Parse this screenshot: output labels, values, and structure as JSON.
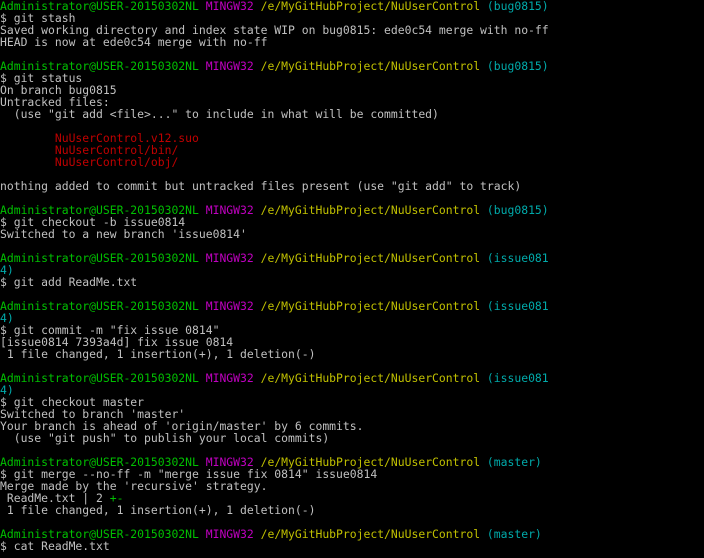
{
  "terminal": {
    "colors": {
      "background": "#000000",
      "text": "#c0c0c0",
      "user": "#00c000",
      "system": "#c000c0",
      "path": "#c0c000",
      "branch": "#00aaaa",
      "untracked": "#c00000"
    },
    "lines": [
      [
        {
          "t": "$ git stash",
          "c": "normal"
        }
      ],
      [
        {
          "t": "Saved working directory and index state WIP on bug0815: ede0c54 merge with no-ff",
          "c": "normal"
        }
      ],
      [
        {
          "t": "HEAD is now at ede0c54 merge with no-ff",
          "c": "normal"
        }
      ],
      [
        {
          "t": "",
          "c": "normal"
        }
      ],
      [
        {
          "t": "Administrator@USER-20150302NL",
          "c": "user"
        },
        {
          "t": " ",
          "c": "normal"
        },
        {
          "t": "MINGW32",
          "c": "sys"
        },
        {
          "t": " ",
          "c": "normal"
        },
        {
          "t": "/e/MyGitHubProject/NuUserControl",
          "c": "path"
        },
        {
          "t": " (bug0815)",
          "c": "branch"
        }
      ],
      [
        {
          "t": "$ git status",
          "c": "normal"
        }
      ],
      [
        {
          "t": "On branch bug0815",
          "c": "normal"
        }
      ],
      [
        {
          "t": "Untracked files:",
          "c": "normal"
        }
      ],
      [
        {
          "t": "  (use \"git add <file>...\" to include in what will be committed)",
          "c": "normal"
        }
      ],
      [
        {
          "t": "",
          "c": "normal"
        }
      ],
      [
        {
          "t": "        NuUserControl.v12.suo",
          "c": "untracked"
        }
      ],
      [
        {
          "t": "        NuUserControl/bin/",
          "c": "untracked"
        }
      ],
      [
        {
          "t": "        NuUserControl/obj/",
          "c": "untracked"
        }
      ],
      [
        {
          "t": "",
          "c": "normal"
        }
      ],
      [
        {
          "t": "nothing added to commit but untracked files present (use \"git add\" to track)",
          "c": "normal"
        }
      ],
      [
        {
          "t": "",
          "c": "normal"
        }
      ],
      [
        {
          "t": "Administrator@USER-20150302NL",
          "c": "user"
        },
        {
          "t": " ",
          "c": "normal"
        },
        {
          "t": "MINGW32",
          "c": "sys"
        },
        {
          "t": " ",
          "c": "normal"
        },
        {
          "t": "/e/MyGitHubProject/NuUserControl",
          "c": "path"
        },
        {
          "t": " (bug0815)",
          "c": "branch"
        }
      ],
      [
        {
          "t": "$ git checkout -b issue0814",
          "c": "normal"
        }
      ],
      [
        {
          "t": "Switched to a new branch 'issue0814'",
          "c": "normal"
        }
      ],
      [
        {
          "t": "",
          "c": "normal"
        }
      ],
      [
        {
          "t": "Administrator@USER-20150302NL",
          "c": "user"
        },
        {
          "t": " ",
          "c": "normal"
        },
        {
          "t": "MINGW32",
          "c": "sys"
        },
        {
          "t": " ",
          "c": "normal"
        },
        {
          "t": "/e/MyGitHubProject/NuUserControl",
          "c": "path"
        },
        {
          "t": " (issue081",
          "c": "branch"
        }
      ],
      [
        {
          "t": "4)",
          "c": "branch"
        }
      ],
      [
        {
          "t": "$ git add ReadMe.txt",
          "c": "normal"
        }
      ],
      [
        {
          "t": "",
          "c": "normal"
        }
      ],
      [
        {
          "t": "Administrator@USER-20150302NL",
          "c": "user"
        },
        {
          "t": " ",
          "c": "normal"
        },
        {
          "t": "MINGW32",
          "c": "sys"
        },
        {
          "t": " ",
          "c": "normal"
        },
        {
          "t": "/e/MyGitHubProject/NuUserControl",
          "c": "path"
        },
        {
          "t": " (issue081",
          "c": "branch"
        }
      ],
      [
        {
          "t": "4)",
          "c": "branch"
        }
      ],
      [
        {
          "t": "$ git commit -m \"fix issue 0814\"",
          "c": "normal"
        }
      ],
      [
        {
          "t": "[issue0814 7393a4d] fix issue 0814",
          "c": "normal"
        }
      ],
      [
        {
          "t": " 1 file changed, 1 insertion(+), 1 deletion(-)",
          "c": "normal"
        }
      ],
      [
        {
          "t": "",
          "c": "normal"
        }
      ],
      [
        {
          "t": "Administrator@USER-20150302NL",
          "c": "user"
        },
        {
          "t": " ",
          "c": "normal"
        },
        {
          "t": "MINGW32",
          "c": "sys"
        },
        {
          "t": " ",
          "c": "normal"
        },
        {
          "t": "/e/MyGitHubProject/NuUserControl",
          "c": "path"
        },
        {
          "t": " (issue081",
          "c": "branch"
        }
      ],
      [
        {
          "t": "4)",
          "c": "branch"
        }
      ],
      [
        {
          "t": "$ git checkout master",
          "c": "normal"
        }
      ],
      [
        {
          "t": "Switched to branch 'master'",
          "c": "normal"
        }
      ],
      [
        {
          "t": "Your branch is ahead of 'origin/master' by 6 commits.",
          "c": "normal"
        }
      ],
      [
        {
          "t": "  (use \"git push\" to publish your local commits)",
          "c": "normal"
        }
      ],
      [
        {
          "t": "",
          "c": "normal"
        }
      ],
      [
        {
          "t": "Administrator@USER-20150302NL",
          "c": "user"
        },
        {
          "t": " ",
          "c": "normal"
        },
        {
          "t": "MINGW32",
          "c": "sys"
        },
        {
          "t": " ",
          "c": "normal"
        },
        {
          "t": "/e/MyGitHubProject/NuUserControl",
          "c": "path"
        },
        {
          "t": " (master)",
          "c": "branch"
        }
      ],
      [
        {
          "t": "$ git merge --no-ff -m \"merge issue fix 0814\" issue0814",
          "c": "normal"
        }
      ],
      [
        {
          "t": "Merge made by the 'recursive' strategy.",
          "c": "normal"
        }
      ],
      [
        {
          "t": " ReadMe.txt | 2 ",
          "c": "normal"
        },
        {
          "t": "+-",
          "c": "added"
        }
      ],
      [
        {
          "t": " 1 file changed, 1 insertion(+), 1 deletion(-)",
          "c": "normal"
        }
      ],
      [
        {
          "t": "",
          "c": "normal"
        }
      ],
      [
        {
          "t": "Administrator@USER-20150302NL",
          "c": "user"
        },
        {
          "t": " ",
          "c": "normal"
        },
        {
          "t": "MINGW32",
          "c": "sys"
        },
        {
          "t": " ",
          "c": "normal"
        },
        {
          "t": "/e/MyGitHubProject/NuUserControl",
          "c": "path"
        },
        {
          "t": " (master)",
          "c": "branch"
        }
      ],
      [
        {
          "t": "$ cat ReadMe.txt",
          "c": "normal"
        }
      ]
    ],
    "first_line_prompt": [
      {
        "t": "Administrator@USER-20150302NL",
        "c": "user"
      },
      {
        "t": " ",
        "c": "normal"
      },
      {
        "t": "MINGW32",
        "c": "sys"
      },
      {
        "t": " ",
        "c": "normal"
      },
      {
        "t": "/e/MyGitHubProject/NuUserControl",
        "c": "path"
      },
      {
        "t": " (bug0815)",
        "c": "branch"
      }
    ]
  }
}
